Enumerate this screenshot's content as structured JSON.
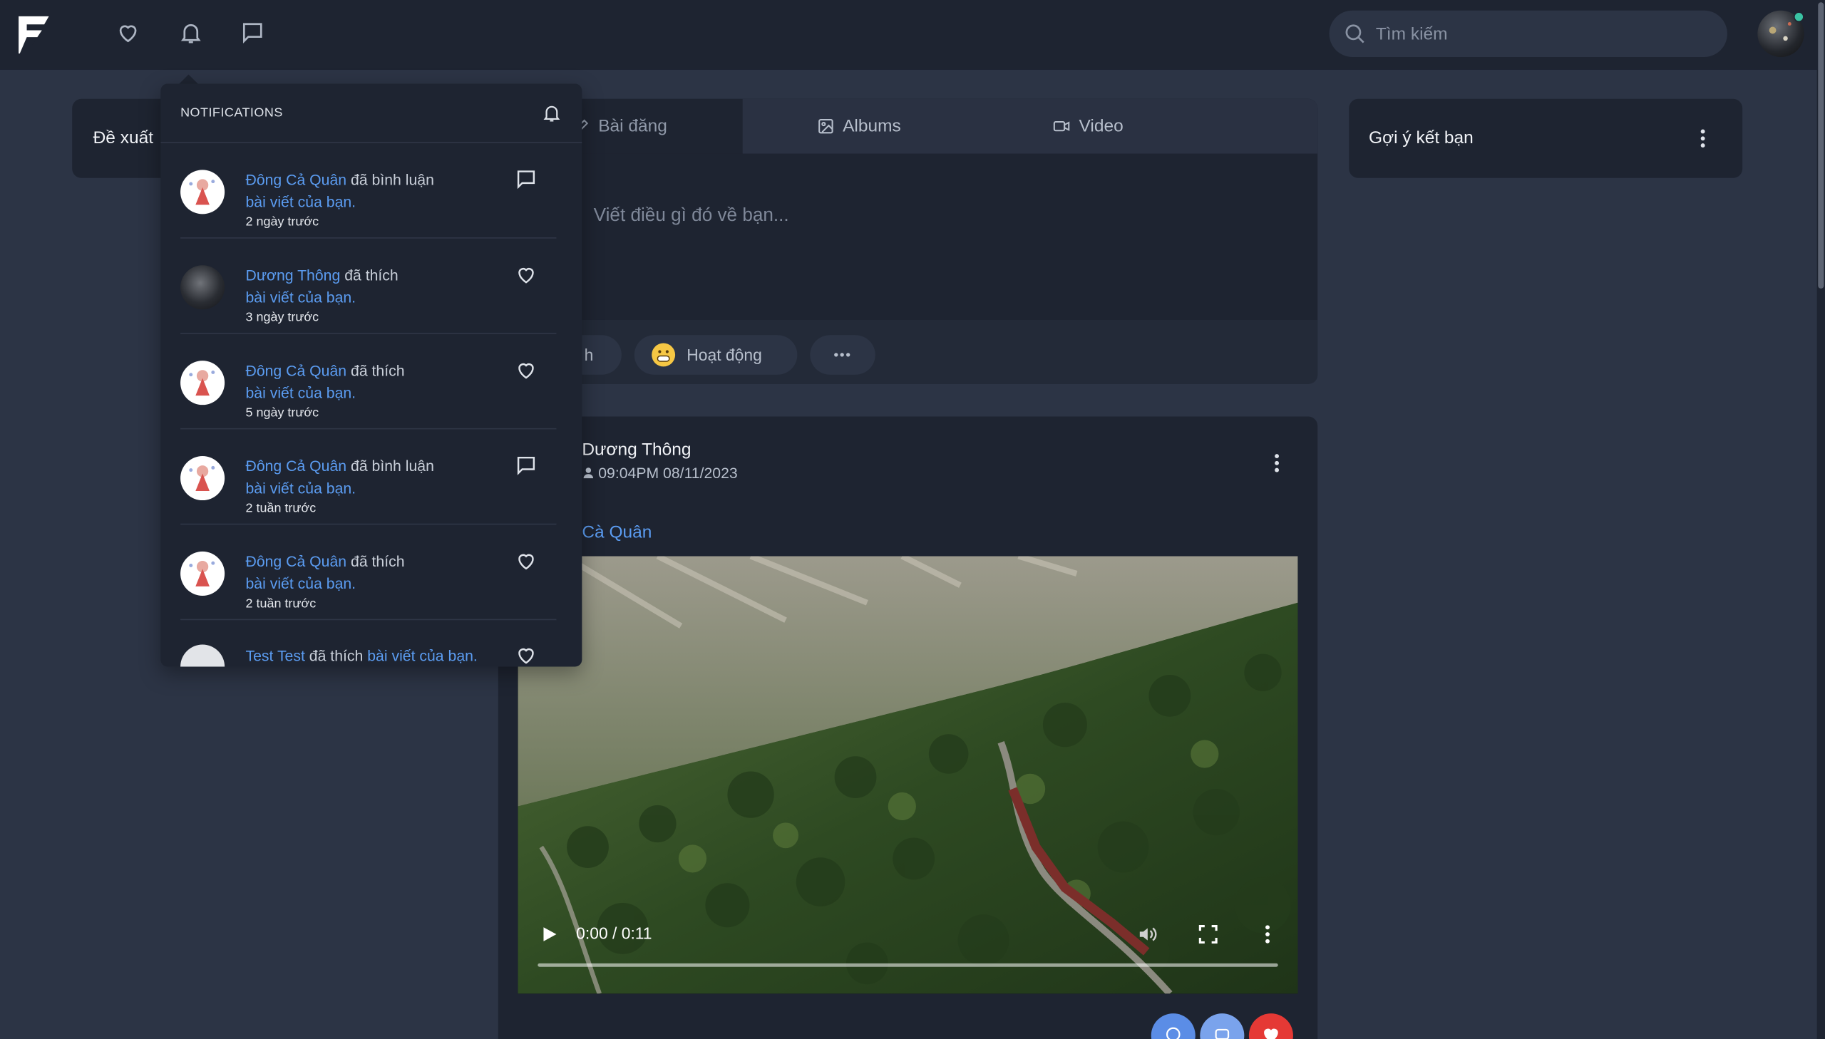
{
  "header": {
    "search_placeholder": "Tìm kiếm"
  },
  "left_card": {
    "title": "Đề xuất"
  },
  "tabs": [
    {
      "label": "Bài đăng",
      "icon": "edit-icon",
      "active": true
    },
    {
      "label": "Albums",
      "icon": "image-icon",
      "active": false
    },
    {
      "label": "Video",
      "icon": "video-icon",
      "active": false
    }
  ],
  "composer": {
    "placeholder": "Viết điều gì đó về bạn...",
    "actions": [
      {
        "label": "h",
        "icon": "image-icon"
      },
      {
        "label": "Hoạt động",
        "icon": "grin-emoji-icon"
      },
      {
        "label": "•••",
        "icon": "more-horizontal-icon"
      }
    ]
  },
  "post": {
    "author": "Dương Thông",
    "time": "09:04PM 08/11/2023",
    "tag": "Cà Quân",
    "video": {
      "current": "0:00",
      "duration": "0:11",
      "time_display": "0:00 / 0:11",
      "progress": 0
    }
  },
  "right_card": {
    "title": "Gợi ý kết bạn"
  },
  "notifications": {
    "title": "NOTIFICATIONS",
    "items": [
      {
        "user": "Đông Cả Quân",
        "action": "đã bình luận",
        "object": "bài viết của bạn.",
        "ago": "2 ngày trước",
        "icon": "comment-icon",
        "avatar": "doll-avatar"
      },
      {
        "user": "Dương Thông",
        "action": "đã thích",
        "object": "bài viết của bạn.",
        "ago": "3 ngày trước",
        "icon": "heart-icon",
        "avatar": "dark-avatar"
      },
      {
        "user": "Đông Cả Quân",
        "action": "đã thích",
        "object": "bài viết của bạn.",
        "ago": "5 ngày trước",
        "icon": "heart-icon",
        "avatar": "doll-avatar"
      },
      {
        "user": "Đông Cả Quân",
        "action": "đã bình luận",
        "object": "bài viết của bạn.",
        "ago": "2 tuần trước",
        "icon": "comment-icon",
        "avatar": "doll-avatar"
      },
      {
        "user": "Đông Cả Quân",
        "action": "đã thích",
        "object": "bài viết của bạn.",
        "ago": "2 tuần trước",
        "icon": "heart-icon",
        "avatar": "doll-avatar"
      },
      {
        "user": "Test Test",
        "action": "đã thích",
        "object": "bài viết của bạn.",
        "ago": "",
        "icon": "heart-icon",
        "avatar": "grey-avatar"
      }
    ]
  },
  "colors": {
    "background": "#2c3445",
    "surface": "#1e2431",
    "link": "#5b9cf1",
    "online": "#3ac3a3",
    "like_red": "#e53935"
  }
}
